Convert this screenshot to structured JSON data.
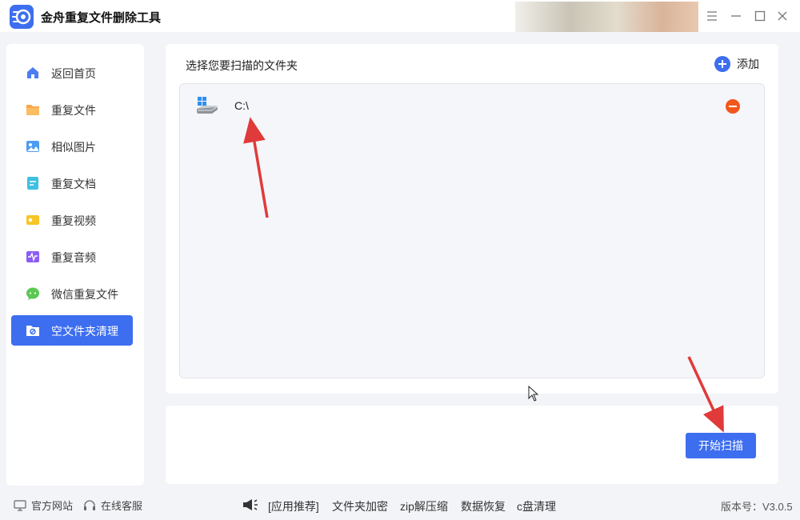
{
  "app": {
    "title": "金舟重复文件删除工具",
    "accent_color": "#3d6ef0"
  },
  "window_controls": [
    {
      "icon": "menu-icon"
    },
    {
      "icon": "minimize-icon"
    },
    {
      "icon": "maximize-icon"
    },
    {
      "icon": "close-icon"
    }
  ],
  "sidebar": {
    "items": [
      {
        "label": "返回首页",
        "icon": "home-icon",
        "active": false
      },
      {
        "label": "重复文件",
        "icon": "folder-icon",
        "active": false
      },
      {
        "label": "相似图片",
        "icon": "image-icon",
        "active": false
      },
      {
        "label": "重复文档",
        "icon": "document-icon",
        "active": false
      },
      {
        "label": "重复视频",
        "icon": "video-icon",
        "active": false
      },
      {
        "label": "重复音频",
        "icon": "audio-icon",
        "active": false
      },
      {
        "label": "微信重复文件",
        "icon": "wechat-icon",
        "active": false
      },
      {
        "label": "空文件夹清理",
        "icon": "empty-folder-icon",
        "active": true
      }
    ]
  },
  "main": {
    "title": "选择您要扫描的文件夹",
    "add_label": "添加",
    "folders": [
      {
        "path": "C:\\",
        "icon": "drive-icon"
      }
    ]
  },
  "actions": {
    "start_scan_label": "开始扫描"
  },
  "footer": {
    "website_label": "官方网站",
    "support_label": "在线客服",
    "recommend_label": "[应用推荐]",
    "links": [
      "文件夹加密",
      "zip解压缩",
      "数据恢复",
      "c盘清理"
    ],
    "version_label": "版本号：V3.0.5"
  }
}
